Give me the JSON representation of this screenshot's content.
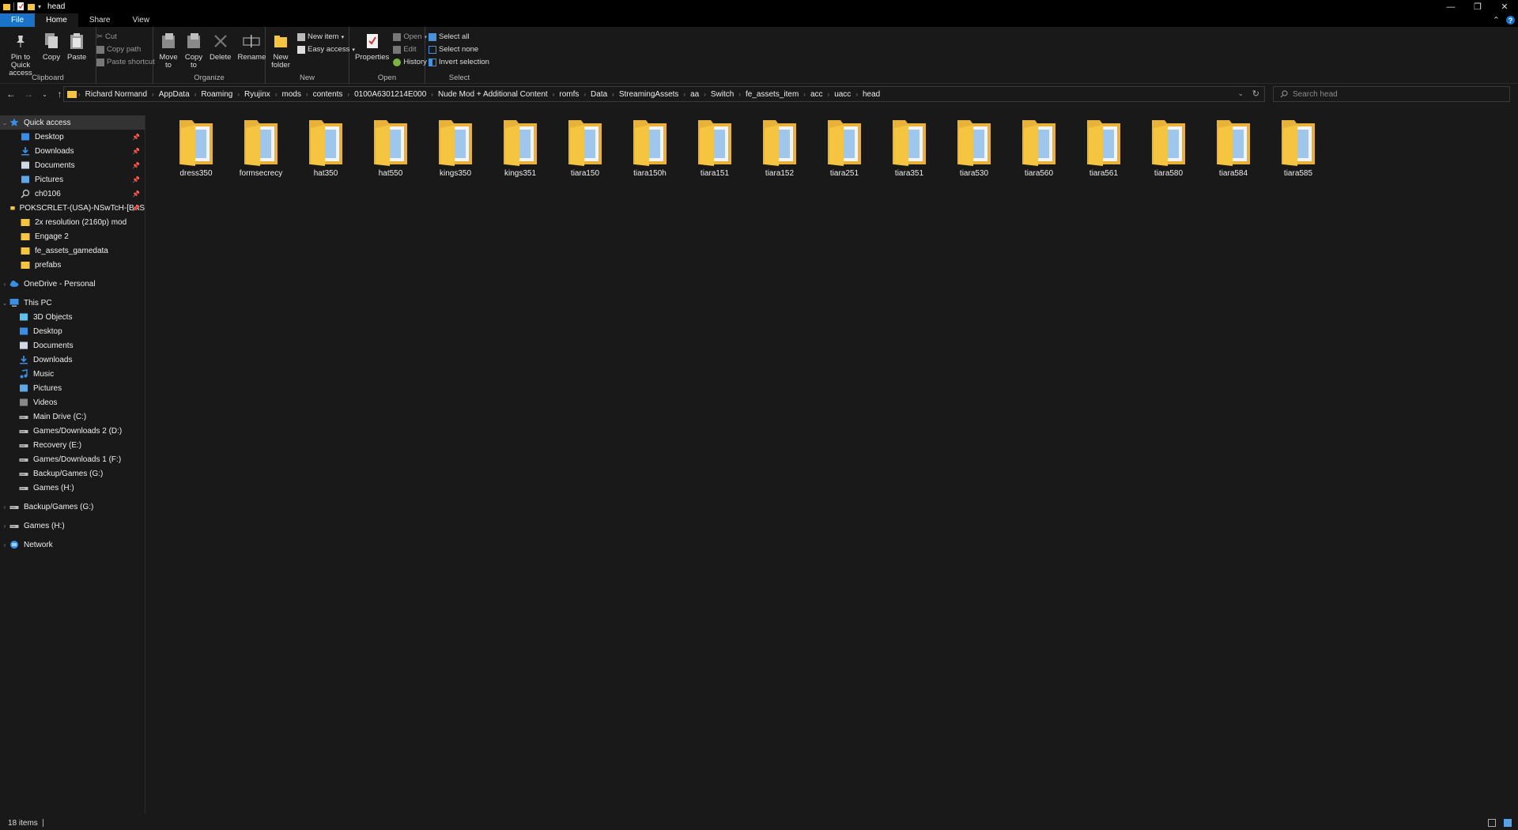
{
  "window": {
    "title": "head"
  },
  "tabs": [
    {
      "label": "File"
    },
    {
      "label": "Home"
    },
    {
      "label": "Share"
    },
    {
      "label": "View"
    }
  ],
  "ribbon": {
    "clipboard": {
      "label": "Clipboard",
      "pin": "Pin to Quick access",
      "copy": "Copy",
      "paste": "Paste",
      "cut": "Cut",
      "copy_path": "Copy path",
      "paste_shortcut": "Paste shortcut"
    },
    "organize": {
      "label": "Organize",
      "move_to": "Move to",
      "copy_to": "Copy to",
      "delete": "Delete",
      "rename": "Rename"
    },
    "new": {
      "label": "New",
      "new_folder": "New folder",
      "new_item": "New item",
      "easy_access": "Easy access"
    },
    "open": {
      "label": "Open",
      "properties": "Properties",
      "open": "Open",
      "edit": "Edit",
      "history": "History"
    },
    "select": {
      "label": "Select",
      "select_all": "Select all",
      "select_none": "Select none",
      "invert": "Invert selection"
    }
  },
  "address": {
    "crumbs": [
      "Richard Normand",
      "AppData",
      "Roaming",
      "Ryujinx",
      "mods",
      "contents",
      "0100A6301214E000",
      "Nude Mod + Additional Content",
      "romfs",
      "Data",
      "StreamingAssets",
      "aa",
      "Switch",
      "fe_assets_item",
      "acc",
      "uacc",
      "head"
    ]
  },
  "search": {
    "placeholder": "Search head"
  },
  "sidebar": {
    "quick_access": "Quick access",
    "quick_items": [
      {
        "label": "Desktop",
        "icon": "desktop-icon",
        "pinned": true
      },
      {
        "label": "Downloads",
        "icon": "download-icon",
        "pinned": true
      },
      {
        "label": "Documents",
        "icon": "documents-icon",
        "pinned": true
      },
      {
        "label": "Pictures",
        "icon": "pictures-icon",
        "pinned": true
      },
      {
        "label": "ch0106",
        "icon": "search-icon",
        "pinned": true
      },
      {
        "label": "POKSCRLET-(USA)-NSwTcH-[BAS",
        "icon": "folder-icon",
        "pinned": true
      },
      {
        "label": "2x resolution (2160p) mod",
        "icon": "folder-icon",
        "pinned": false
      },
      {
        "label": "Engage 2",
        "icon": "folder-icon",
        "pinned": false
      },
      {
        "label": "fe_assets_gamedata",
        "icon": "folder-icon",
        "pinned": false
      },
      {
        "label": "prefabs",
        "icon": "folder-icon",
        "pinned": false
      }
    ],
    "onedrive": "OneDrive - Personal",
    "this_pc": "This PC",
    "pc_items": [
      {
        "label": "3D Objects",
        "icon": "3d-objects-icon"
      },
      {
        "label": "Desktop",
        "icon": "desktop-icon"
      },
      {
        "label": "Documents",
        "icon": "documents-icon"
      },
      {
        "label": "Downloads",
        "icon": "download-icon"
      },
      {
        "label": "Music",
        "icon": "music-icon"
      },
      {
        "label": "Pictures",
        "icon": "pictures-icon"
      },
      {
        "label": "Videos",
        "icon": "videos-icon"
      },
      {
        "label": "Main Drive (C:)",
        "icon": "drive-icon"
      },
      {
        "label": "Games/Downloads 2 (D:)",
        "icon": "drive-icon"
      },
      {
        "label": "Recovery (E:)",
        "icon": "drive-icon"
      },
      {
        "label": "Games/Downloads 1 (F:)",
        "icon": "drive-icon"
      },
      {
        "label": "Backup/Games (G:)",
        "icon": "drive-icon"
      },
      {
        "label": "Games (H:)",
        "icon": "drive-icon"
      }
    ],
    "drives_root": [
      {
        "label": "Backup/Games (G:)"
      },
      {
        "label": "Games (H:)"
      }
    ],
    "network": "Network"
  },
  "folders": [
    "dress350",
    "formsecrecy",
    "hat350",
    "hat550",
    "kings350",
    "kings351",
    "tiara150",
    "tiara150h",
    "tiara151",
    "tiara152",
    "tiara251",
    "tiara351",
    "tiara530",
    "tiara560",
    "tiara561",
    "tiara580",
    "tiara584",
    "tiara585"
  ],
  "status": {
    "count": "18 items"
  },
  "colors": {
    "accent": "#1a73c9",
    "folder": "#f5c542",
    "background": "#191919"
  }
}
